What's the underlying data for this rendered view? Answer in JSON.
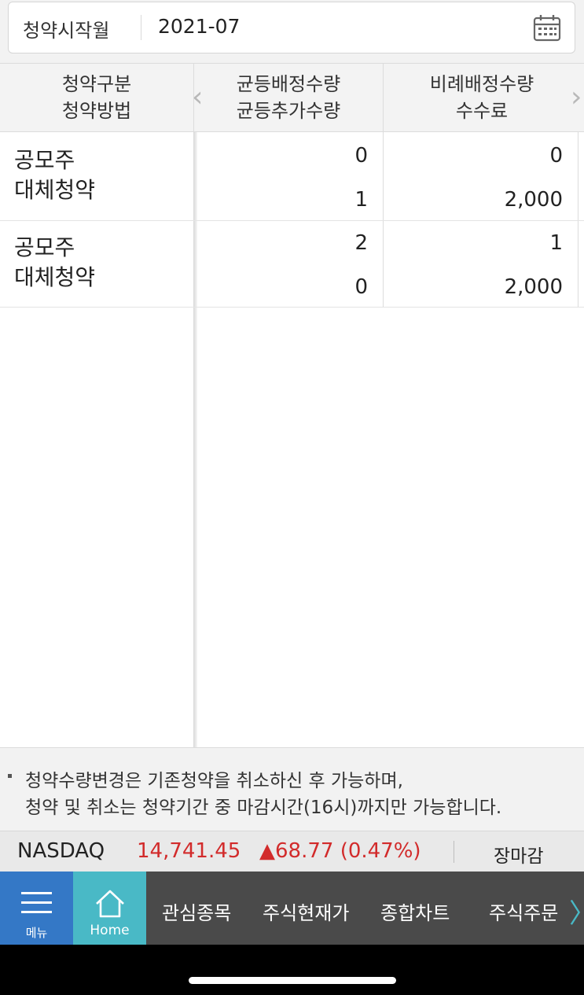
{
  "filter": {
    "label": "청약시작월",
    "month": "2021-07"
  },
  "table": {
    "headers": {
      "col1": [
        "청약구분",
        "청약방법"
      ],
      "col2": [
        "균등배정수량",
        "균등추가수량"
      ],
      "col3": [
        "비례배정수량",
        "수수료"
      ]
    },
    "rows": [
      {
        "name": [
          "공모주",
          "대체청약"
        ],
        "equal_alloc": "0",
        "equal_extra": "1",
        "prop_alloc": "0",
        "fee": "2,000"
      },
      {
        "name": [
          "공모주",
          "대체청약"
        ],
        "equal_alloc": "2",
        "equal_extra": "0",
        "prop_alloc": "1",
        "fee": "2,000"
      }
    ]
  },
  "notice": {
    "lines": [
      "청약수량변경은 기존청약을 취소하신 후 가능하며,",
      "청약 및 취소는 청약기간 중 마감시간(16시)까지만 가능합니다."
    ]
  },
  "ticker": {
    "name": "NASDAQ",
    "price": "14,741.45",
    "change": "▲68.77 (0.47%)",
    "status": "장마감",
    "color_up": "#d22b2b"
  },
  "bottom_nav": {
    "menu_label": "메뉴",
    "home_label": "Home",
    "items": [
      "관심종목",
      "주식현재가",
      "종합차트",
      "주식주문"
    ],
    "colors": {
      "menu": "#3478c6",
      "home": "#49b9c6",
      "bar": "#4a4a4a"
    }
  }
}
